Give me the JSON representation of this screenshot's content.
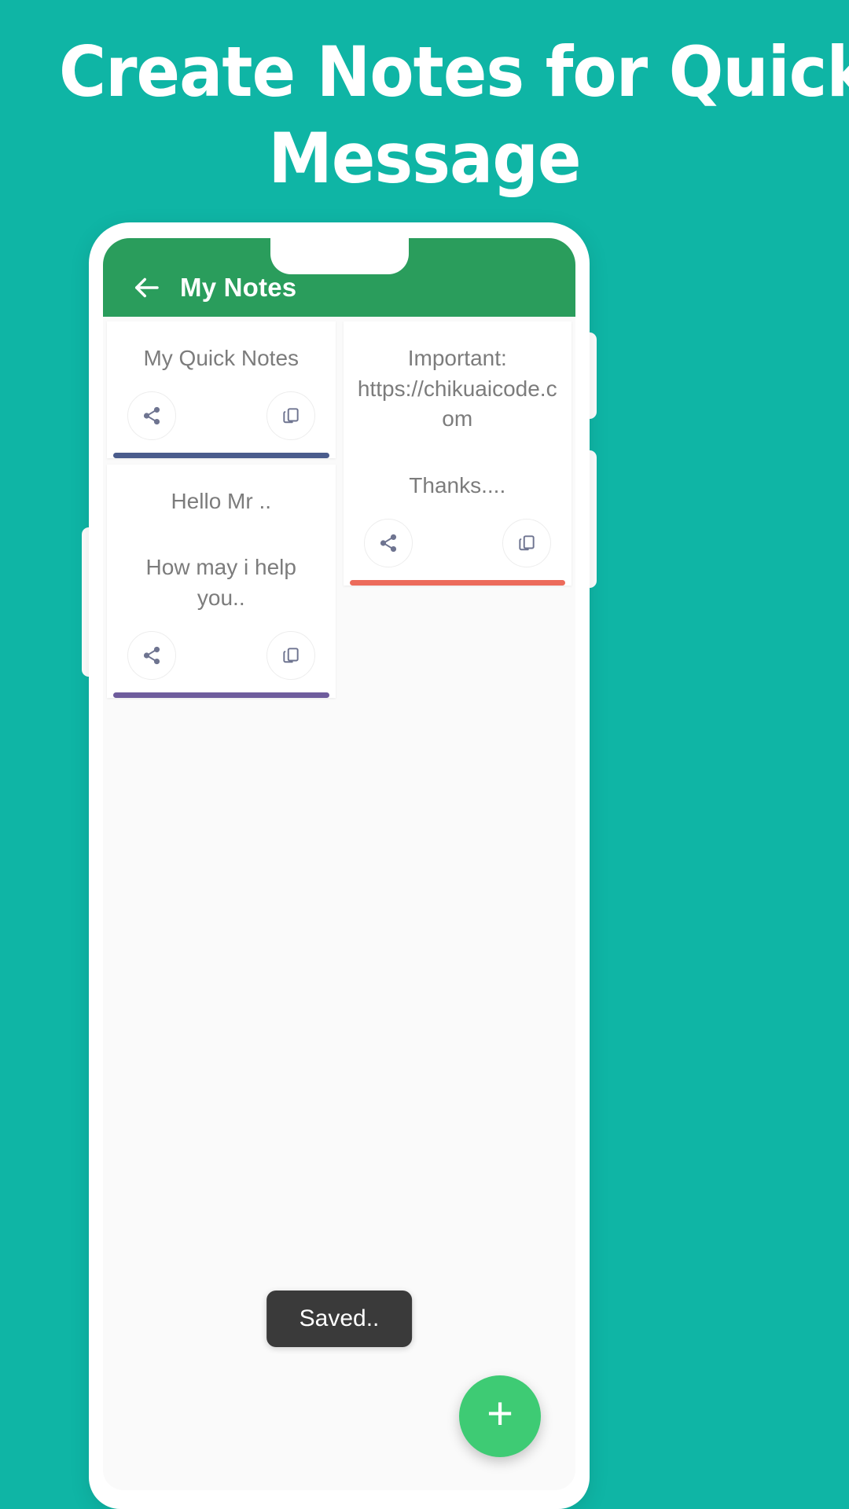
{
  "promo": {
    "headline_line1": "Create Notes for Quick",
    "headline_line2": "Message",
    "background_color": "#0FB5A5"
  },
  "app": {
    "appbar": {
      "back_icon": "arrow-left-icon",
      "title": "My Notes",
      "background_color": "#2A9D5C"
    },
    "notes": [
      {
        "text": "My Quick Notes",
        "text2": "",
        "accent_color": "#4A5C8C",
        "share_icon": "share-icon",
        "copy_icon": "copy-icon"
      },
      {
        "text": "Important: https://chikuaicode.com",
        "text2": "Thanks....",
        "accent_color": "#EC6B5B",
        "share_icon": "share-icon",
        "copy_icon": "copy-icon"
      },
      {
        "text": "Hello Mr ..",
        "text2": "How may i help you..",
        "accent_color": "#6E5C9C",
        "share_icon": "share-icon",
        "copy_icon": "copy-icon"
      }
    ],
    "toast": {
      "message": "Saved..",
      "background_color": "#3A3A3A"
    },
    "fab": {
      "label": "+",
      "icon": "plus-icon",
      "color": "#3ECB74"
    }
  }
}
